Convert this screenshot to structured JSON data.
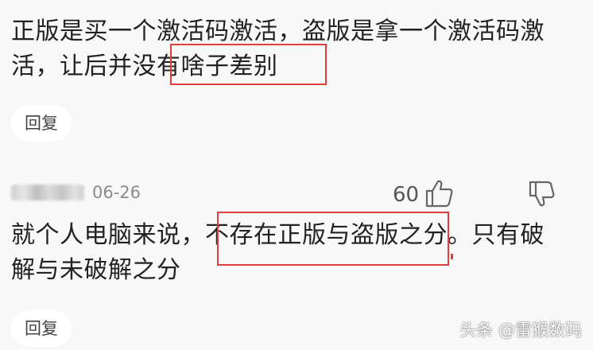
{
  "comment1": {
    "line1": "正版是买一个激活码激活，盗版是拿一个激活码激",
    "line2": "活，让后并没有啥子差别",
    "reply_label": "回复"
  },
  "comment2": {
    "date": "06-26",
    "like_count": "60",
    "line1": "就个人电脑来说，不存在正版与盗版之分。只有破",
    "line2": "解与未破解之分",
    "reply_label": "回复"
  },
  "watermark": "头条 @雷猴数码",
  "colors": {
    "highlight": "#e23d3d",
    "background": "#f8f8f8"
  },
  "icons": [
    "thumbs-up-icon",
    "thumbs-down-icon"
  ]
}
